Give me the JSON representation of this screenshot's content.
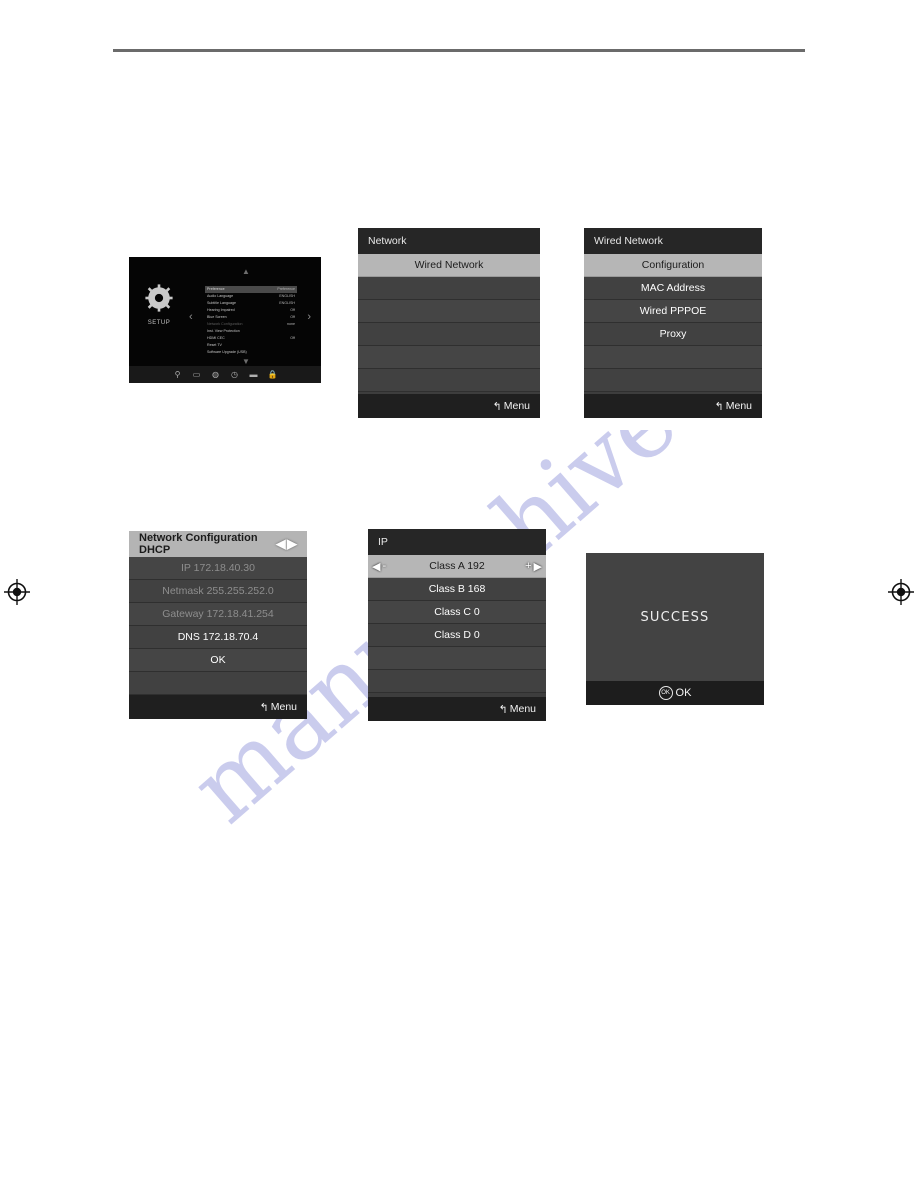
{
  "page": {
    "watermark": "manualshive.com"
  },
  "setup_screen": {
    "name": "setup-menu-screen",
    "sidebar_label": "SETUP",
    "sidebar_icon": "gear-icon",
    "nav_left_icon": "chevron-left-icon",
    "nav_right_icon": "chevron-right-icon",
    "scroll_up_icon": "chevron-up-icon",
    "scroll_down_icon": "chevron-down-icon",
    "menu_items": [
      {
        "label": "Preference",
        "value": "Preference",
        "state": "highlight"
      },
      {
        "label": "Audio Language",
        "value": "ENGLISH",
        "state": "normal"
      },
      {
        "label": "Subtitle Language",
        "value": "ENGLISH",
        "state": "normal"
      },
      {
        "label": "Hearing Impaired",
        "value": "Off",
        "state": "normal"
      },
      {
        "label": "Blue Screen",
        "value": "Off",
        "state": "normal"
      },
      {
        "label": "Network Configuration",
        "value": "none",
        "state": "disabled"
      },
      {
        "label": "Inst. View Protection",
        "value": "",
        "state": "normal"
      },
      {
        "label": "HDMI CEC",
        "value": "Off",
        "state": "normal"
      },
      {
        "label": "Reset TV",
        "value": "",
        "state": "normal"
      },
      {
        "label": "Software Upgrade (USB)",
        "value": "",
        "state": "normal"
      }
    ],
    "bottom_icons": [
      "satellite-icon",
      "tv-icon",
      "globe-icon",
      "clock-icon",
      "bar-icon",
      "lock-icon"
    ]
  },
  "panel_network": {
    "title": "Network",
    "footer_label": "Menu",
    "footer_icon": "back-arrow-icon",
    "rows": [
      {
        "label": "Wired Network",
        "selected": true
      },
      {
        "label": "",
        "selected": false
      },
      {
        "label": "",
        "selected": false
      },
      {
        "label": "",
        "selected": false
      },
      {
        "label": "",
        "selected": false
      },
      {
        "label": "",
        "selected": false
      }
    ]
  },
  "panel_wired_network": {
    "title": "Wired Network",
    "footer_label": "Menu",
    "footer_icon": "back-arrow-icon",
    "rows": [
      {
        "label": "Configuration",
        "selected": true
      },
      {
        "label": "MAC Address",
        "selected": false
      },
      {
        "label": "Wired PPPOE",
        "selected": false
      },
      {
        "label": "Proxy",
        "selected": false
      },
      {
        "label": "",
        "selected": false
      },
      {
        "label": "",
        "selected": false
      }
    ]
  },
  "panel_dhcp": {
    "title": "Network Configuration DHCP",
    "title_arrows": "◀▶",
    "left_arrow_icon": "arrow-left-icon",
    "right_arrow_icon": "arrow-right-icon",
    "footer_label": "Menu",
    "footer_icon": "back-arrow-icon",
    "rows": [
      {
        "label": "IP 172.18.40.30",
        "dim": true
      },
      {
        "label": "Netmask 255.255.252.0",
        "dim": true
      },
      {
        "label": "Gateway 172.18.41.254",
        "dim": true
      },
      {
        "label": "DNS 172.18.70.4",
        "dim": false
      },
      {
        "label": "OK",
        "dim": false
      },
      {
        "label": "",
        "dim": false
      }
    ]
  },
  "panel_ip": {
    "title": "IP",
    "footer_label": "Menu",
    "footer_icon": "back-arrow-icon",
    "decrement_label": "-",
    "increment_label": "+",
    "left_arrow_icon": "arrow-left-icon",
    "right_arrow_icon": "arrow-right-icon",
    "rows": [
      {
        "label": "Class A 192",
        "selected": true
      },
      {
        "label": "Class B 168",
        "selected": false
      },
      {
        "label": "Class C 0",
        "selected": false
      },
      {
        "label": "Class D 0",
        "selected": false
      },
      {
        "label": "",
        "selected": false
      },
      {
        "label": "",
        "selected": false
      }
    ]
  },
  "panel_success": {
    "message": "SUCCESS",
    "footer_label": "OK",
    "footer_icon": "ok-circle-icon",
    "ok_glyph": "OK"
  },
  "colors": {
    "panel_bg": "#3d3d3d",
    "row_bg": "#454545",
    "row_selected": "#b6b6b6",
    "header_dark": "#262626",
    "header_light": "#b4b4b4",
    "footer_bg": "#1f1f1f",
    "text": "#ffffff",
    "watermark": "#b9bbe8",
    "rule": "#6b6b6b"
  }
}
